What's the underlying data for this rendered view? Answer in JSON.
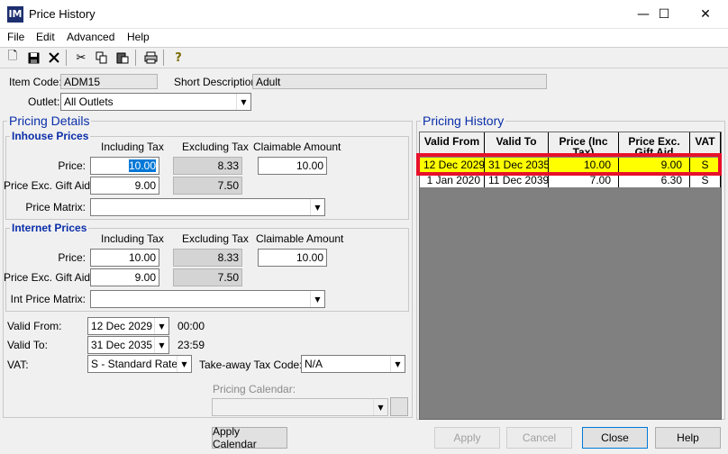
{
  "window": {
    "title": "Price History",
    "minimize": "—",
    "maximize": "☐",
    "close": "✕"
  },
  "menu": [
    "File",
    "Edit",
    "Advanced",
    "Help"
  ],
  "toolbar": [
    "new-icon",
    "save-icon",
    "delete-icon",
    "cut-icon",
    "copy-icon",
    "paste-icon",
    "print-icon",
    "help-icon"
  ],
  "header": {
    "item_code_label": "Item Code:",
    "item_code": "ADM15",
    "short_desc_label": "Short Description:",
    "short_desc": "Adult",
    "outlet_label": "Outlet:",
    "outlet": "All Outlets"
  },
  "pricing_details": {
    "title": "Pricing Details",
    "inhouse": {
      "title": "Inhouse Prices",
      "col_incl": "Including Tax",
      "col_excl": "Excluding Tax",
      "col_claim": "Claimable Amount",
      "price_label": "Price:",
      "price_incl": "10.00",
      "price_excl": "8.33",
      "price_claim": "10.00",
      "gift_label": "Price Exc. Gift Aid:",
      "gift_incl": "9.00",
      "gift_excl": "7.50",
      "matrix_label": "Price Matrix:",
      "matrix": ""
    },
    "internet": {
      "title": "Internet Prices",
      "col_incl": "Including Tax",
      "col_excl": "Excluding Tax",
      "col_claim": "Claimable Amount",
      "price_label": "Price:",
      "price_incl": "10.00",
      "price_excl": "8.33",
      "price_claim": "10.00",
      "gift_label": "Price Exc. Gift Aid:",
      "gift_incl": "9.00",
      "gift_excl": "7.50",
      "matrix_label": "Int Price Matrix:",
      "matrix": ""
    },
    "valid_from_label": "Valid From:",
    "valid_from": "12 Dec 2029",
    "valid_from_time": "00:00",
    "valid_to_label": "Valid To:",
    "valid_to": "31 Dec 2035",
    "valid_to_time": "23:59",
    "vat_label": "VAT:",
    "vat": "S - Standard Rate",
    "takeaway_label": "Take-away Tax Code:",
    "takeaway": "N/A",
    "calendar_label": "Pricing Calendar:",
    "calendar": ""
  },
  "pricing_history": {
    "title": "Pricing History",
    "columns": [
      "Valid From",
      "Valid To",
      "Price (Inc Tax)",
      "Price Exc. Gift Aid",
      "VAT"
    ],
    "rows": [
      {
        "from": "12 Dec 2029",
        "to": "31 Dec 2035",
        "price": "10.00",
        "gift": "9.00",
        "vat": "S"
      },
      {
        "from": "1 Jan 2020",
        "to": "11 Dec 2039",
        "price": "7.00",
        "gift": "6.30",
        "vat": "S"
      }
    ]
  },
  "buttons": {
    "apply_calendar": "Apply Calendar",
    "apply": "Apply",
    "cancel": "Cancel",
    "close": "Close",
    "help": "Help"
  },
  "colors": {
    "highlight_row": "#ffff00",
    "highlight_border": "#e8102a",
    "group_title": "#0a2ea8"
  }
}
